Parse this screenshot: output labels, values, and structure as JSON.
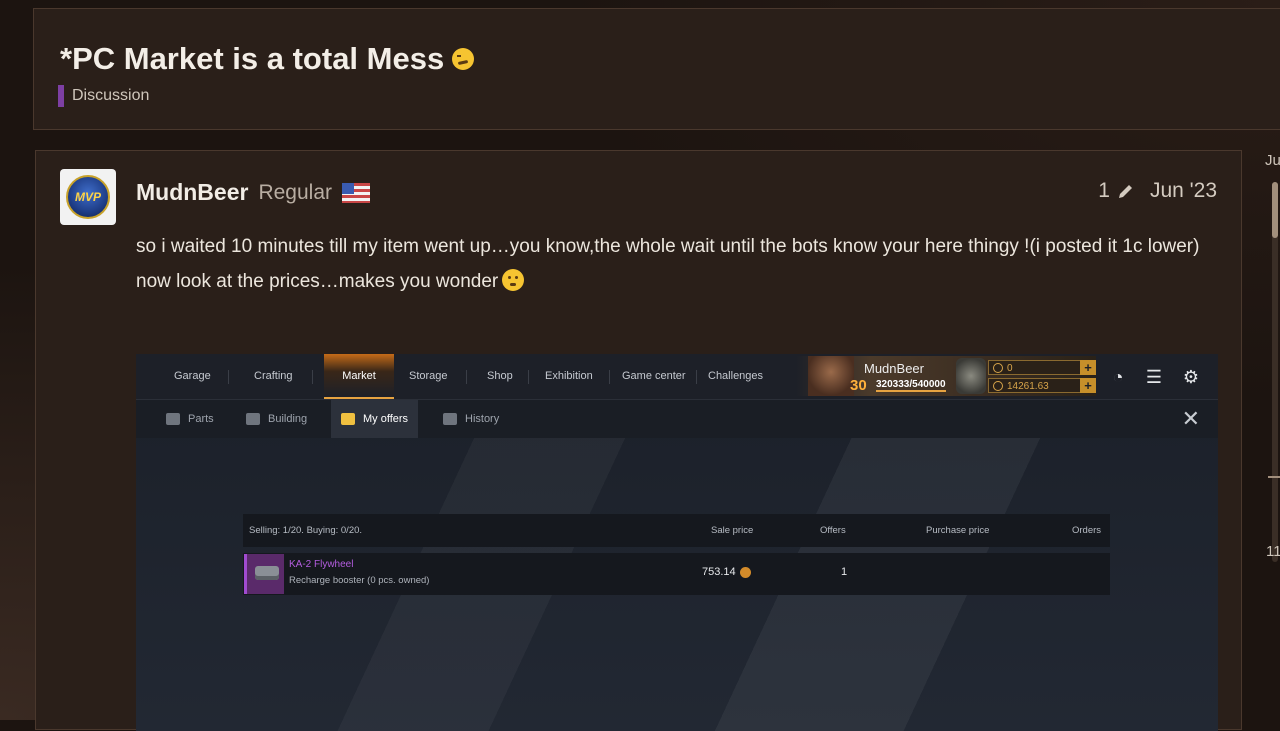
{
  "topic": {
    "title": "*PC Market is a total Mess",
    "category": "Discussion"
  },
  "post": {
    "username": "MudnBeer",
    "user_title": "Regular",
    "edit_count": "1",
    "date": "Jun '23",
    "avatar_text": "MVP",
    "body_line1": "so i waited 10 minutes till my item went up…you know,the whole wait until the bots know your here thingy !(i posted it 1c lower)",
    "body_line2": "now look at the prices…makes you wonder"
  },
  "game": {
    "nav_tabs": [
      "Garage",
      "Crafting",
      "Market",
      "Storage",
      "Shop",
      "Exhibition",
      "Game center",
      "Challenges"
    ],
    "active_tab": "Market",
    "player": {
      "name": "MudnBeer",
      "level": "30",
      "xp": "320333/540000",
      "currency1": "0",
      "currency2": "14261.63"
    },
    "sub_tabs": [
      "Parts",
      "Building",
      "My offers",
      "History"
    ],
    "active_sub_tab": "My offers",
    "offers_header": {
      "summary": "Selling: 1/20. Buying: 0/20.",
      "sale_price": "Sale price",
      "offers": "Offers",
      "purchase_price": "Purchase price",
      "orders": "Orders"
    },
    "offer_row": {
      "item_name": "KA-2 Flywheel",
      "item_desc": "Recharge booster (0 pcs. owned)",
      "sale_price": "753.14",
      "offers": "1"
    }
  },
  "timeline": {
    "top_label": "Ju",
    "bottom_label": "11"
  },
  "colors": {
    "category": "#7d3fa3",
    "rare_item": "#b45de0",
    "game_accent": "#e7a341"
  }
}
